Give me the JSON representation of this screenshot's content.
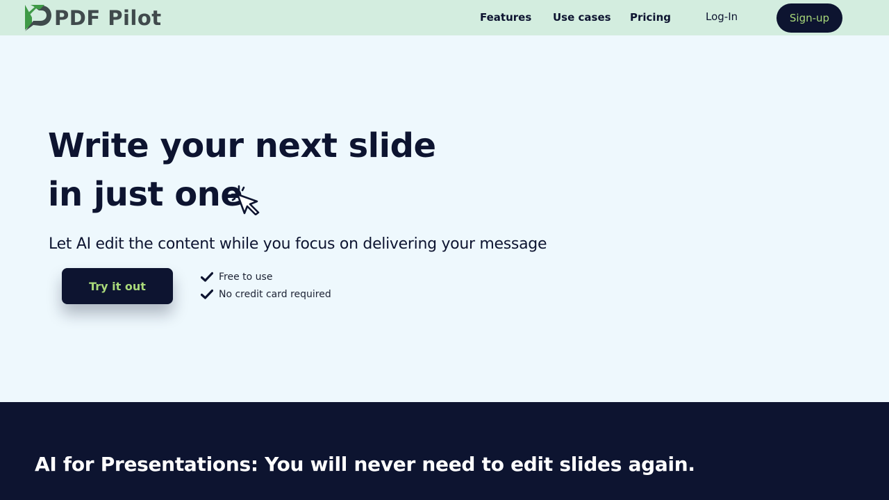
{
  "brand": {
    "name": "PDF Pilot"
  },
  "nav": {
    "links": [
      "Features",
      "Use cases",
      "Pricing"
    ],
    "login": "Log-In",
    "signup": "Sign-up"
  },
  "hero": {
    "headline_line1": "Write your next slide",
    "headline_line2": "in just one",
    "headline_icon": "cursor-click-icon",
    "subheadline": "Let AI edit the content while you focus on delivering your message",
    "cta": "Try it out",
    "perks": [
      "Free to use",
      "No credit card required"
    ]
  },
  "section": {
    "title": "AI for Presentations: You will never need to edit slides again."
  },
  "colors": {
    "navbar_bg": "#d3eddf",
    "page_bg": "#eef8fd",
    "navy": "#0d1430",
    "accent_green": "#a9d97a",
    "logo_green": "#3f9a47",
    "logo_gray": "#404a4c"
  }
}
